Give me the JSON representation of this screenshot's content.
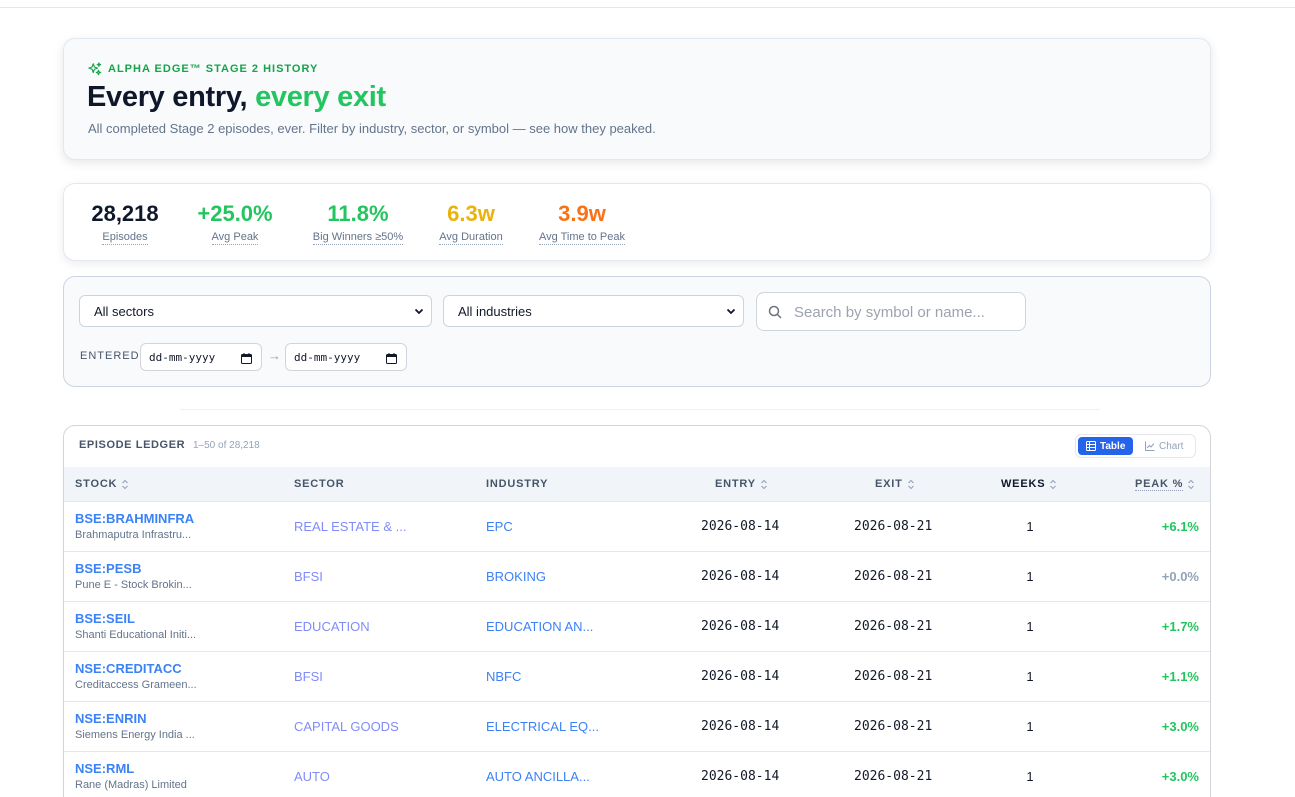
{
  "hero": {
    "eyebrow": "ALPHA EDGE™ STAGE 2 HISTORY",
    "title_main": "Every entry, ",
    "title_accent": "every exit",
    "subtitle": "All completed Stage 2 episodes, ever. Filter by industry, sector, or symbol — see how they peaked."
  },
  "stats": [
    {
      "value": "28,218",
      "label": "Episodes",
      "color": "#0f172a"
    },
    {
      "value": "+25.0%",
      "label": "Avg Peak",
      "color": "#22c55e"
    },
    {
      "value": "11.8%",
      "label": "Big Winners ≥50%",
      "color": "#22c55e"
    },
    {
      "value": "6.3w",
      "label": "Avg Duration",
      "color": "#eab308"
    },
    {
      "value": "3.9w",
      "label": "Avg Time to Peak",
      "color": "#f97316"
    }
  ],
  "filters": {
    "sector_value": "All sectors",
    "industry_value": "All industries",
    "search_placeholder": "Search by symbol or name...",
    "entered_label": "ENTERED",
    "date_from": "dd-mm-yyyy",
    "date_to": "dd-mm-yyyy",
    "arrow": "→"
  },
  "ledger": {
    "title": "EPISODE LEDGER",
    "count": "1–50 of 28,218",
    "view_table": "Table",
    "view_chart": "Chart",
    "columns": [
      "STOCK",
      "SECTOR",
      "INDUSTRY",
      "ENTRY",
      "EXIT",
      "WEEKS",
      "PEAK %"
    ],
    "rows": [
      {
        "symbol": "BSE:BRAHMINFRA",
        "name": "Brahmaputra Infrastru...",
        "sector": "REAL ESTATE & ...",
        "industry": "EPC",
        "entry": "2026-08-14",
        "exit": "2026-08-21",
        "weeks": "1",
        "peak": "+6.1%",
        "peak_color": "#22c55e"
      },
      {
        "symbol": "BSE:PESB",
        "name": "Pune E - Stock Brokin...",
        "sector": "BFSI",
        "industry": "BROKING",
        "entry": "2026-08-14",
        "exit": "2026-08-21",
        "weeks": "1",
        "peak": "+0.0%",
        "peak_color": "#94a3b8"
      },
      {
        "symbol": "BSE:SEIL",
        "name": "Shanti Educational Initi...",
        "sector": "EDUCATION",
        "industry": "EDUCATION AN...",
        "entry": "2026-08-14",
        "exit": "2026-08-21",
        "weeks": "1",
        "peak": "+1.7%",
        "peak_color": "#22c55e"
      },
      {
        "symbol": "NSE:CREDITACC",
        "name": "Creditaccess Grameen...",
        "sector": "BFSI",
        "industry": "NBFC",
        "entry": "2026-08-14",
        "exit": "2026-08-21",
        "weeks": "1",
        "peak": "+1.1%",
        "peak_color": "#22c55e"
      },
      {
        "symbol": "NSE:ENRIN",
        "name": "Siemens Energy India ...",
        "sector": "CAPITAL GOODS",
        "industry": "ELECTRICAL EQ...",
        "entry": "2026-08-14",
        "exit": "2026-08-21",
        "weeks": "1",
        "peak": "+3.0%",
        "peak_color": "#22c55e"
      },
      {
        "symbol": "NSE:RML",
        "name": "Rane (Madras) Limited",
        "sector": "AUTO",
        "industry": "AUTO ANCILLA...",
        "entry": "2026-08-14",
        "exit": "2026-08-21",
        "weeks": "1",
        "peak": "+3.0%",
        "peak_color": "#22c55e"
      }
    ]
  }
}
